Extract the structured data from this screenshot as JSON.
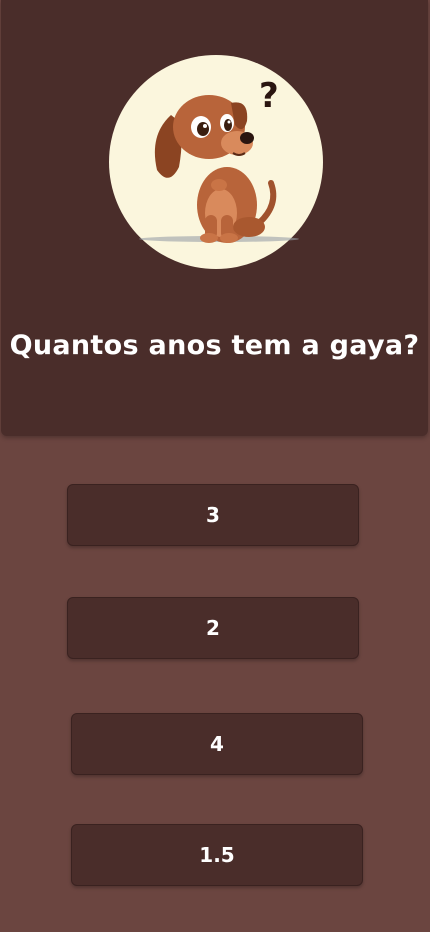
{
  "quiz": {
    "question": "Quantos anos tem a gaya?",
    "image_icon": "confused-dachshund-puppy-icon",
    "answers": [
      "3",
      "2",
      "4",
      "1.5"
    ]
  },
  "colors": {
    "background": "#6b4540",
    "card": "#4a2d2a",
    "text": "#ffffff",
    "avatar_bg": "#fbf6dd"
  }
}
